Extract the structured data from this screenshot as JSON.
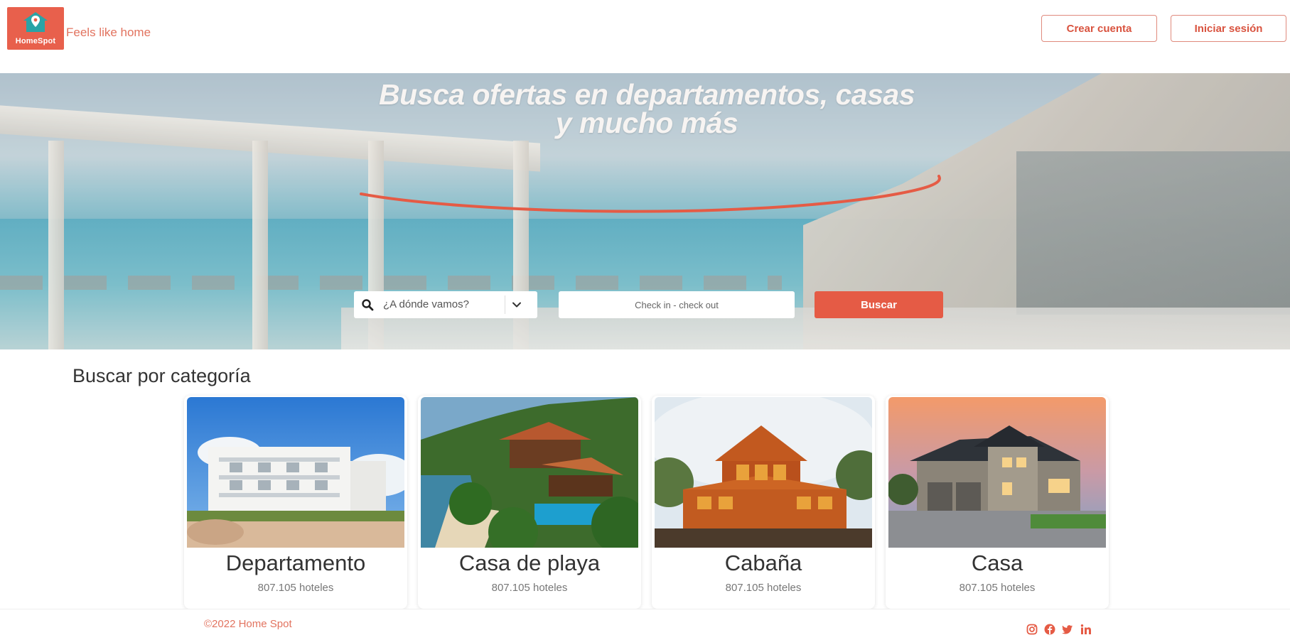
{
  "brand": {
    "logo_text": "HomeSpot",
    "tagline": "Feels like home",
    "accent": "#e55b45"
  },
  "header": {
    "create_account": "Crear cuenta",
    "login": "Iniciar sesión"
  },
  "hero": {
    "title_line1": "Busca ofertas en departamentos, casas",
    "title_line2": "y mucho más",
    "search_placeholder": "¿A dónde vamos?",
    "dates_placeholder": "Check in - check out",
    "search_button": "Buscar"
  },
  "categories": {
    "title": "Buscar por categoría",
    "items": [
      {
        "name": "Departamento",
        "count": "807.105 hoteles"
      },
      {
        "name": "Casa de playa",
        "count": "807.105 hoteles"
      },
      {
        "name": "Cabaña",
        "count": "807.105 hoteles"
      },
      {
        "name": "Casa",
        "count": "807.105 hoteles"
      }
    ]
  },
  "footer": {
    "copyright": "©2022 Home Spot",
    "social_icons": [
      "instagram-icon",
      "facebook-icon",
      "twitter-icon",
      "linkedin-icon"
    ]
  }
}
